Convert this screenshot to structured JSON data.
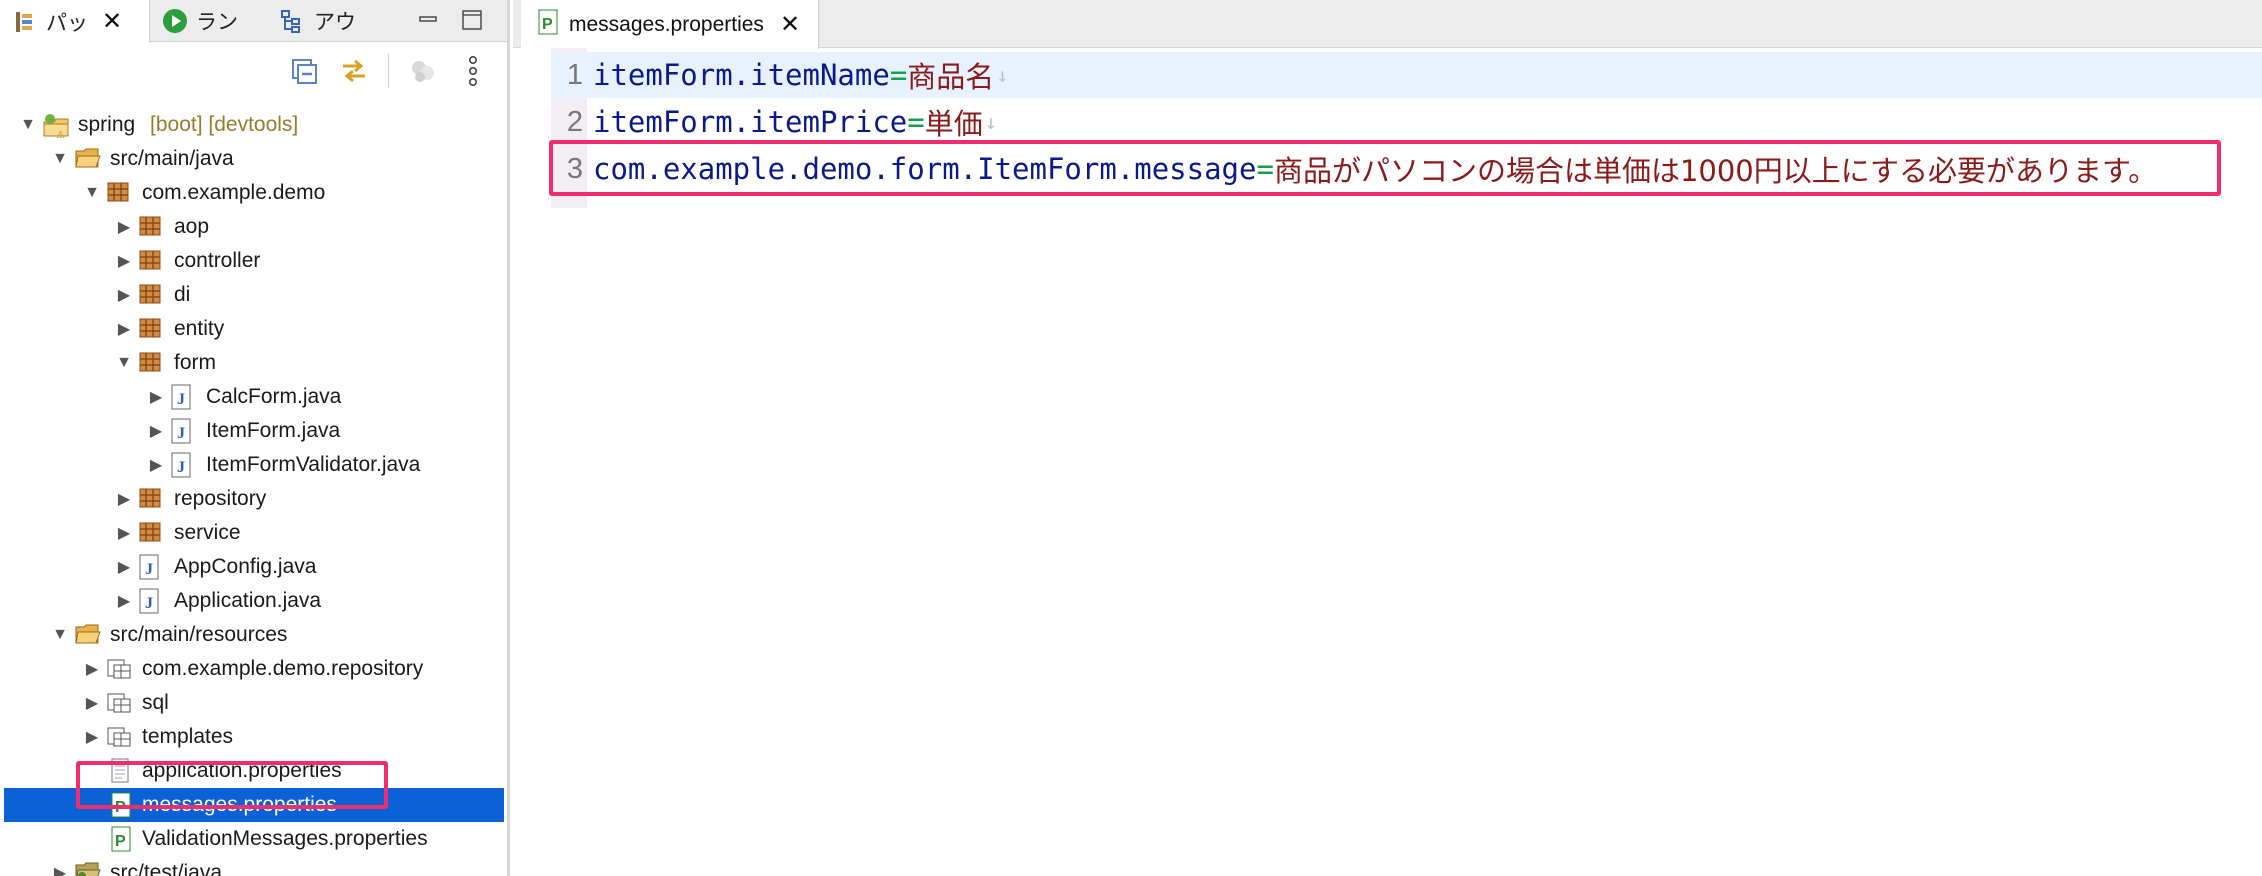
{
  "left_panel": {
    "tabs": [
      {
        "label": "パッ",
        "icon": "package-explorer-icon",
        "active": true
      },
      {
        "label": "ラン",
        "icon": "run-icon",
        "active": false
      },
      {
        "label": "アウ",
        "icon": "outline-icon",
        "active": false
      }
    ],
    "close_glyph": "✕",
    "toolbar_icons": [
      "collapse-all-icon",
      "link-with-editor-icon",
      "filter-icon",
      "view-menu-icon"
    ],
    "tree": {
      "project": {
        "name": "spring",
        "decorations": "[boot] [devtools]"
      },
      "src_main_java": "src/main/java",
      "pkg_demo": "com.example.demo",
      "packages": [
        "aop",
        "controller",
        "di",
        "entity",
        "form"
      ],
      "form_files": [
        "CalcForm.java",
        "ItemForm.java",
        "ItemFormValidator.java"
      ],
      "packages_after": [
        "repository",
        "service"
      ],
      "demo_files": [
        "AppConfig.java",
        "Application.java"
      ],
      "src_main_resources": "src/main/resources",
      "resource_folders": [
        "com.example.demo.repository",
        "sql",
        "templates"
      ],
      "resource_files": [
        "application.properties",
        "messages.properties",
        "ValidationMessages.properties"
      ],
      "selected": "messages.properties",
      "src_test_java": "src/test/java"
    }
  },
  "editor": {
    "tab": {
      "label": "messages.properties",
      "icon": "properties-file-icon",
      "close_glyph": "✕"
    },
    "lines": [
      {
        "num": "1",
        "key": "itemForm.itemName",
        "eq": "=",
        "value": "商品名",
        "eol": "↓"
      },
      {
        "num": "2",
        "key": "itemForm.itemPrice",
        "eq": "=",
        "value": "単価",
        "eol": "↓"
      },
      {
        "num": "3",
        "key": "com.example.demo.form.ItemForm.message",
        "eq": "=",
        "value": "商品がパソコンの場合は単価は1000円以上にする必要があります。",
        "eol": ""
      }
    ]
  },
  "colors": {
    "selection": "#0b62d6",
    "highlight_box": "#ef2e6f",
    "key": "#0a1a8c",
    "equals": "#10a14a",
    "value": "#8b1a1a"
  }
}
